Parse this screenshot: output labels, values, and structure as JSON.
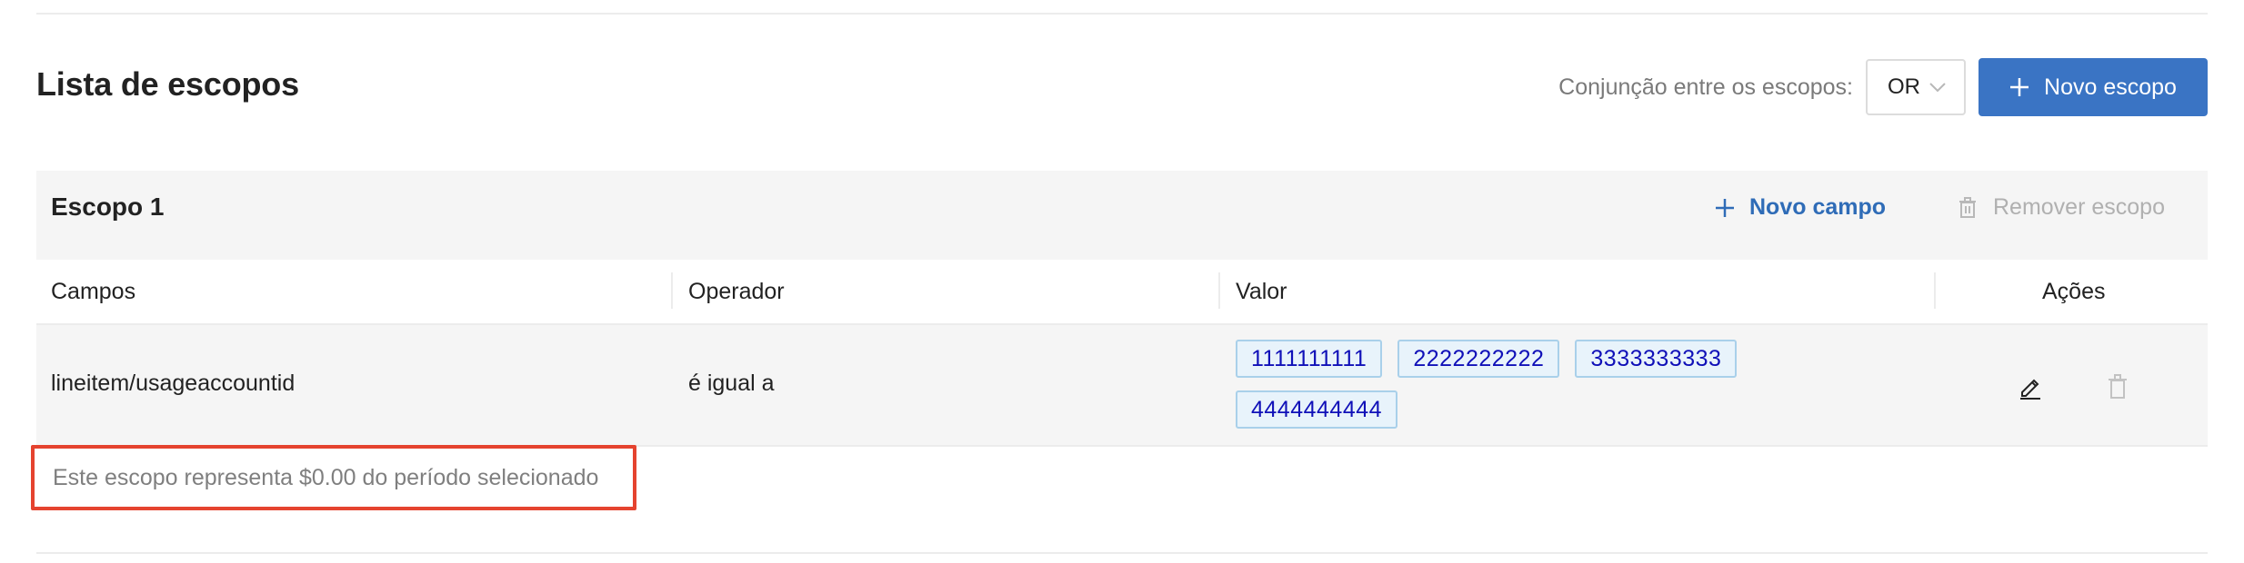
{
  "header": {
    "title": "Lista de escopos",
    "conjunction_label": "Conjunção entre os escopos:",
    "conjunction_value": "OR",
    "new_scope_label": "Novo escopo"
  },
  "scope": {
    "title": "Escopo 1",
    "new_field_label": "Novo campo",
    "remove_scope_label": "Remover escopo"
  },
  "table": {
    "columns": [
      "Campos",
      "Operador",
      "Valor",
      "Ações"
    ],
    "rows": [
      {
        "field": "lineitem/usageaccountid",
        "operator": "é igual a",
        "values": [
          "1111111111",
          "2222222222",
          "3333333333",
          "4444444444"
        ]
      }
    ]
  },
  "summary": {
    "text": "Este escopo representa $0.00 do período selecionado"
  },
  "colors": {
    "primary": "#3a74c4",
    "link": "#2f6cb7",
    "tag_bg": "#e8f3fb",
    "tag_border": "#a9d0ea",
    "tag_text": "#1010b8",
    "highlight": "#e5432f"
  },
  "icons": {
    "add": "plus-icon",
    "dropdown": "chevron-down-icon",
    "edit": "pencil-icon",
    "delete": "trash-icon"
  }
}
